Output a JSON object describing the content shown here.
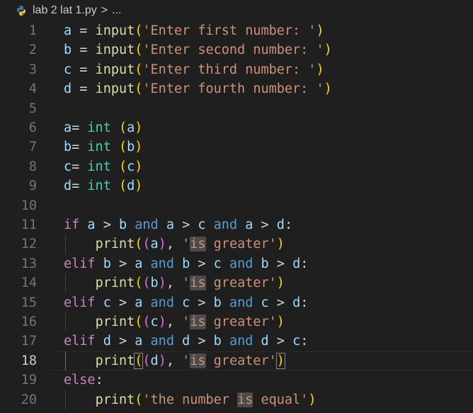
{
  "breadcrumb": {
    "filename": "lab 2 lat 1.py",
    "separator": ">",
    "more": "..."
  },
  "editor": {
    "current_line": 18,
    "lines": [
      {
        "n": "1",
        "tokens": [
          [
            "var",
            "a"
          ],
          [
            "op",
            " = "
          ],
          [
            "fn",
            "input"
          ],
          [
            "p1",
            "("
          ],
          [
            "str",
            "'Enter first number: '"
          ],
          [
            "p1",
            ")"
          ]
        ]
      },
      {
        "n": "2",
        "tokens": [
          [
            "var",
            "b"
          ],
          [
            "op",
            " = "
          ],
          [
            "fn",
            "input"
          ],
          [
            "p1",
            "("
          ],
          [
            "str",
            "'Enter second number: '"
          ],
          [
            "p1",
            ")"
          ]
        ]
      },
      {
        "n": "3",
        "tokens": [
          [
            "var",
            "c"
          ],
          [
            "op",
            " = "
          ],
          [
            "fn",
            "input"
          ],
          [
            "p1",
            "("
          ],
          [
            "str",
            "'Enter third number: '"
          ],
          [
            "p1",
            ")"
          ]
        ]
      },
      {
        "n": "4",
        "tokens": [
          [
            "var",
            "d"
          ],
          [
            "op",
            " = "
          ],
          [
            "fn",
            "input"
          ],
          [
            "p1",
            "("
          ],
          [
            "str",
            "'Enter fourth number: '"
          ],
          [
            "p1",
            ")"
          ]
        ]
      },
      {
        "n": "5",
        "tokens": []
      },
      {
        "n": "6",
        "tokens": [
          [
            "var",
            "a"
          ],
          [
            "op",
            "= "
          ],
          [
            "typ",
            "int"
          ],
          [
            "op",
            " "
          ],
          [
            "p1",
            "("
          ],
          [
            "var",
            "a"
          ],
          [
            "p1",
            ")"
          ]
        ]
      },
      {
        "n": "7",
        "tokens": [
          [
            "var",
            "b"
          ],
          [
            "op",
            "= "
          ],
          [
            "typ",
            "int"
          ],
          [
            "op",
            " "
          ],
          [
            "p1",
            "("
          ],
          [
            "var",
            "b"
          ],
          [
            "p1",
            ")"
          ]
        ]
      },
      {
        "n": "8",
        "tokens": [
          [
            "var",
            "c"
          ],
          [
            "op",
            "= "
          ],
          [
            "typ",
            "int"
          ],
          [
            "op",
            " "
          ],
          [
            "p1",
            "("
          ],
          [
            "var",
            "c"
          ],
          [
            "p1",
            ")"
          ]
        ]
      },
      {
        "n": "9",
        "tokens": [
          [
            "var",
            "d"
          ],
          [
            "op",
            "= "
          ],
          [
            "typ",
            "int"
          ],
          [
            "op",
            " "
          ],
          [
            "p1",
            "("
          ],
          [
            "var",
            "d"
          ],
          [
            "p1",
            ")"
          ]
        ]
      },
      {
        "n": "10",
        "tokens": []
      },
      {
        "n": "11",
        "tokens": [
          [
            "kw",
            "if"
          ],
          [
            "op",
            " "
          ],
          [
            "var",
            "a"
          ],
          [
            "op",
            " > "
          ],
          [
            "var",
            "b"
          ],
          [
            "op",
            " "
          ],
          [
            "and",
            "and"
          ],
          [
            "op",
            " "
          ],
          [
            "var",
            "a"
          ],
          [
            "op",
            " > "
          ],
          [
            "var",
            "c"
          ],
          [
            "op",
            " "
          ],
          [
            "and",
            "and"
          ],
          [
            "op",
            " "
          ],
          [
            "var",
            "a"
          ],
          [
            "op",
            " > "
          ],
          [
            "var",
            "d"
          ],
          [
            "op",
            ":"
          ]
        ]
      },
      {
        "n": "12",
        "indent": true,
        "tokens": [
          [
            "op",
            "    "
          ],
          [
            "fn",
            "print"
          ],
          [
            "p1",
            "("
          ],
          [
            "p2",
            "("
          ],
          [
            "var",
            "a"
          ],
          [
            "p2",
            ")"
          ],
          [
            "op",
            ", "
          ],
          [
            "str",
            "'"
          ],
          [
            "str hl",
            "is"
          ],
          [
            "str",
            " greater'"
          ],
          [
            "p1",
            ")"
          ]
        ]
      },
      {
        "n": "13",
        "tokens": [
          [
            "kw",
            "elif"
          ],
          [
            "op",
            " "
          ],
          [
            "var",
            "b"
          ],
          [
            "op",
            " > "
          ],
          [
            "var",
            "a"
          ],
          [
            "op",
            " "
          ],
          [
            "and",
            "and"
          ],
          [
            "op",
            " "
          ],
          [
            "var",
            "b"
          ],
          [
            "op",
            " > "
          ],
          [
            "var",
            "c"
          ],
          [
            "op",
            " "
          ],
          [
            "and",
            "and"
          ],
          [
            "op",
            " "
          ],
          [
            "var",
            "b"
          ],
          [
            "op",
            " > "
          ],
          [
            "var",
            "d"
          ],
          [
            "op",
            ":"
          ]
        ]
      },
      {
        "n": "14",
        "indent": true,
        "tokens": [
          [
            "op",
            "    "
          ],
          [
            "fn",
            "print"
          ],
          [
            "p1",
            "("
          ],
          [
            "p2",
            "("
          ],
          [
            "var",
            "b"
          ],
          [
            "p2",
            ")"
          ],
          [
            "op",
            ", "
          ],
          [
            "str",
            "'"
          ],
          [
            "str hl",
            "is"
          ],
          [
            "str",
            " greater'"
          ],
          [
            "p1",
            ")"
          ]
        ]
      },
      {
        "n": "15",
        "tokens": [
          [
            "kw",
            "elif"
          ],
          [
            "op",
            " "
          ],
          [
            "var",
            "c"
          ],
          [
            "op",
            " > "
          ],
          [
            "var",
            "a"
          ],
          [
            "op",
            " "
          ],
          [
            "and",
            "and"
          ],
          [
            "op",
            " "
          ],
          [
            "var",
            "c"
          ],
          [
            "op",
            " > "
          ],
          [
            "var",
            "b"
          ],
          [
            "op",
            " "
          ],
          [
            "and",
            "and"
          ],
          [
            "op",
            " "
          ],
          [
            "var",
            "c"
          ],
          [
            "op",
            " > "
          ],
          [
            "var",
            "d"
          ],
          [
            "op",
            ":"
          ]
        ]
      },
      {
        "n": "16",
        "indent": true,
        "tokens": [
          [
            "op",
            "    "
          ],
          [
            "fn",
            "print"
          ],
          [
            "p1",
            "("
          ],
          [
            "p2",
            "("
          ],
          [
            "var",
            "c"
          ],
          [
            "p2",
            ")"
          ],
          [
            "op",
            ", "
          ],
          [
            "str",
            "'"
          ],
          [
            "str hl",
            "is"
          ],
          [
            "str",
            " greater'"
          ],
          [
            "p1",
            ")"
          ]
        ]
      },
      {
        "n": "17",
        "tokens": [
          [
            "kw",
            "elif"
          ],
          [
            "op",
            " "
          ],
          [
            "var",
            "d"
          ],
          [
            "op",
            " > "
          ],
          [
            "var",
            "a"
          ],
          [
            "op",
            " "
          ],
          [
            "and",
            "and"
          ],
          [
            "op",
            " "
          ],
          [
            "var",
            "d"
          ],
          [
            "op",
            " > "
          ],
          [
            "var",
            "b"
          ],
          [
            "op",
            " "
          ],
          [
            "and",
            "and"
          ],
          [
            "op",
            " "
          ],
          [
            "var",
            "d"
          ],
          [
            "op",
            " > "
          ],
          [
            "var",
            "c"
          ],
          [
            "op",
            ":"
          ]
        ]
      },
      {
        "n": "18",
        "indent": true,
        "active": true,
        "tokens": [
          [
            "op",
            "    "
          ],
          [
            "fn",
            "print"
          ],
          [
            "p1 bracket-box",
            "("
          ],
          [
            "p2",
            "("
          ],
          [
            "var",
            "d"
          ],
          [
            "p2",
            ")"
          ],
          [
            "op",
            ", "
          ],
          [
            "str",
            "'"
          ],
          [
            "caret",
            ""
          ],
          [
            "str hl",
            "is"
          ],
          [
            "str",
            " greater'"
          ],
          [
            "p1 bracket-box",
            ")"
          ]
        ]
      },
      {
        "n": "19",
        "tokens": [
          [
            "kw",
            "else"
          ],
          [
            "op",
            ":"
          ]
        ]
      },
      {
        "n": "20",
        "indent": true,
        "tokens": [
          [
            "op",
            "    "
          ],
          [
            "fn",
            "print"
          ],
          [
            "p1",
            "("
          ],
          [
            "str",
            "'the number "
          ],
          [
            "str hl",
            "is"
          ],
          [
            "str",
            " equal'"
          ],
          [
            "p1",
            ")"
          ]
        ]
      }
    ]
  },
  "colors": {
    "background": "#1f1f1f",
    "variable": "#9cdcfe",
    "function": "#dcdcaa",
    "string": "#ce9178",
    "keyword_control": "#c586c0",
    "keyword_and": "#569cd6",
    "type": "#4ec9b0",
    "bracket_level_1": "#ffd700",
    "bracket_level_2": "#da70d6"
  },
  "icons": {
    "file_type": "python-file-icon",
    "breadcrumb_separator": "chevron-right-icon"
  }
}
